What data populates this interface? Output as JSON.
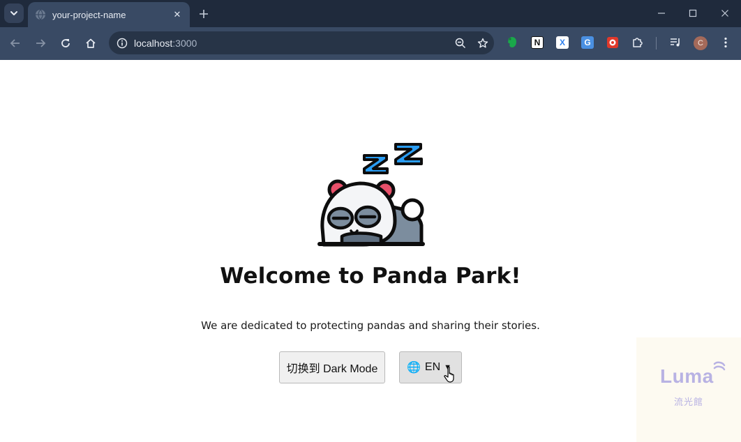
{
  "browser": {
    "tab": {
      "title": "your-project-name",
      "close_glyph": "✕"
    },
    "new_tab_glyph": "+",
    "url_host": "localhost",
    "url_port": ":3000",
    "avatar_letter": "C",
    "extensions": [
      {
        "name": "evernote-extension-icon",
        "color": "#1aa84a"
      },
      {
        "name": "notion-extension-icon",
        "label": "N",
        "color": "#ffffff"
      },
      {
        "name": "x-extension-icon",
        "label": "X",
        "color": "#2f80ed"
      },
      {
        "name": "translate-extension-icon",
        "label": "G",
        "color": "#4a90e2"
      },
      {
        "name": "red-extension-icon",
        "color": "#e0392b"
      }
    ]
  },
  "page": {
    "title": "Welcome to Panda Park!",
    "subtitle": "We are dedicated to protecting pandas and sharing their stories.",
    "dark_mode_button": "切换到 Dark Mode",
    "language_button": "EN",
    "language_globe": "🌐",
    "language_caret": "▼"
  },
  "watermark": {
    "logo": "Luma",
    "sub": "流光館"
  },
  "colors": {
    "chrome_bg": "#1f2a3c",
    "toolbar_bg": "#394a64",
    "panda_ear": "#e8506a",
    "panda_z": "#2a9df4"
  }
}
